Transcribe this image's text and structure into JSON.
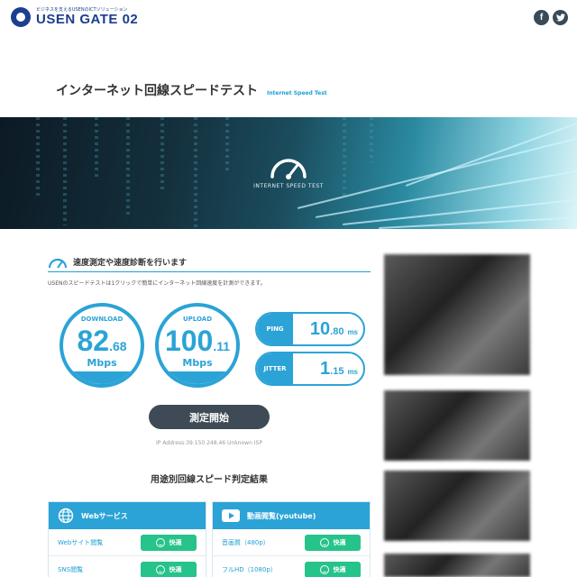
{
  "header": {
    "logo_tagline": "ビジネスを支えるUSENのICTソリューション",
    "logo_name": "USEN GATE 02",
    "social": [
      {
        "icon": "facebook-icon",
        "glyph": "f"
      },
      {
        "icon": "twitter-icon",
        "glyph": "t"
      }
    ]
  },
  "page": {
    "title": "インターネット回線スピードテスト",
    "subtitle": "Internet Speed Test"
  },
  "hero": {
    "label": "INTERNET SPEED TEST",
    "icon": "speedometer-icon"
  },
  "section": {
    "heading": "速度測定や速度診断を行います",
    "description": "USENのスピードテストは1クリックで簡単にインターネット回線速度を計測ができます。"
  },
  "metrics": {
    "download": {
      "label": "DOWNLOAD",
      "int": "82",
      "dec": ".68",
      "unit": "Mbps"
    },
    "upload": {
      "label": "UPLOAD",
      "int": "100",
      "dec": ".11",
      "unit": "Mbps"
    },
    "ping": {
      "label": "PING",
      "int": "10",
      "dec": ".80",
      "unit": "ms"
    },
    "jitter": {
      "label": "JITTER",
      "int": "1",
      "dec": ".15",
      "unit": "ms"
    }
  },
  "start_button": "測定開始",
  "ip_info": "IP Address:39.150.248.46 Unknown ISP",
  "results": {
    "title": "用途別回線スピード判定結果",
    "cards": [
      {
        "header": "Webサービス",
        "icon": "globe-icon",
        "rows": [
          {
            "label": "Webサイト閲覧",
            "status": "快適"
          },
          {
            "label": "SNS閲覧",
            "status": "快適"
          }
        ]
      },
      {
        "header": "動画閲覧(youtube)",
        "icon": "play-icon",
        "rows": [
          {
            "label": "音画質（480p）",
            "status": "快適"
          },
          {
            "label": "フルHD（1080p）",
            "status": "快適"
          }
        ]
      }
    ]
  },
  "colors": {
    "accent": "#2ba3d6",
    "ok": "#26c38a",
    "button": "#3e4b56",
    "brand": "#1a3f8f"
  }
}
